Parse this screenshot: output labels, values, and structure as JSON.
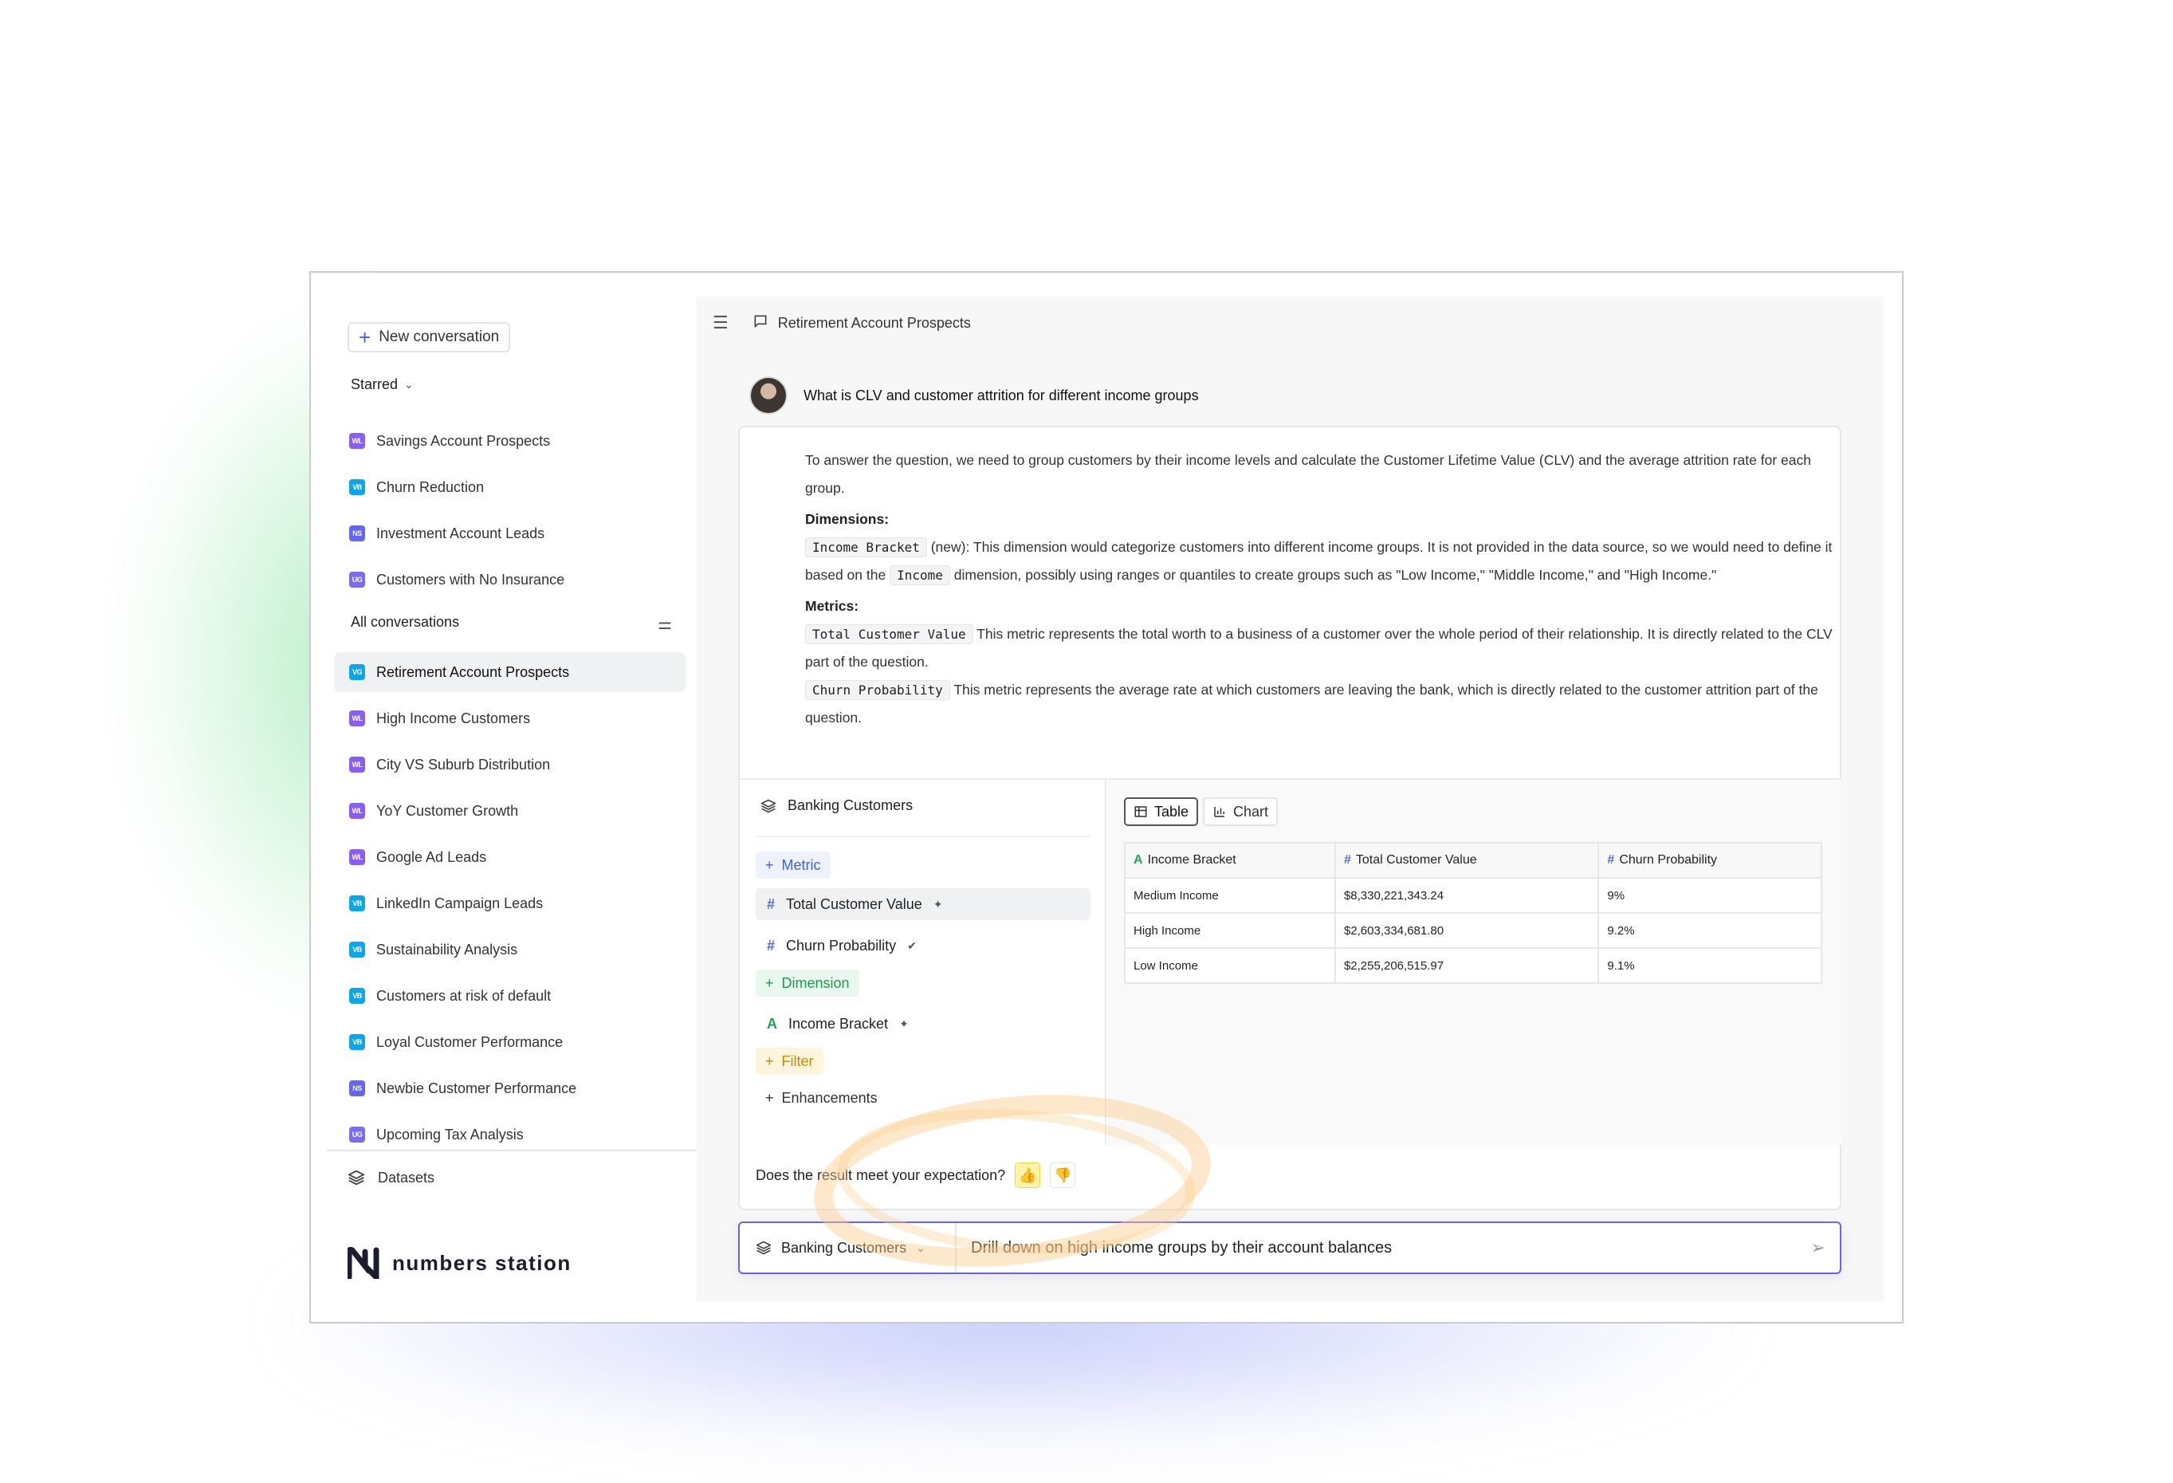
{
  "colors": {
    "accent": "#4b5cf0",
    "badge_wl": "#8b5cf6",
    "badge_vb": "#0ea5e9",
    "badge_ns": "#6366f1",
    "badge_ug": "#7c6cf0",
    "metric": "#3a63e0",
    "dimension": "#1e9a4f",
    "filter": "#c98a00"
  },
  "sidebar": {
    "new_conversation": "New conversation",
    "starred_label": "Starred",
    "starred": [
      {
        "badge": "WL",
        "label": "Savings Account Prospects"
      },
      {
        "badge": "VB",
        "label": "Churn Reduction"
      },
      {
        "badge": "NS",
        "label": "Investment Account Leads"
      },
      {
        "badge": "UG",
        "label": "Customers with No Insurance"
      }
    ],
    "all_label": "All conversations",
    "conversations": [
      {
        "badge": "VG",
        "label": "Retirement Account Prospects"
      },
      {
        "badge": "WL",
        "label": "High Income Customers"
      },
      {
        "badge": "WL",
        "label": "City VS Suburb Distribution"
      },
      {
        "badge": "WL",
        "label": "YoY Customer Growth"
      },
      {
        "badge": "WL",
        "label": "Google Ad Leads"
      },
      {
        "badge": "VB",
        "label": "LinkedIn Campaign Leads"
      },
      {
        "badge": "VB",
        "label": "Sustainability Analysis"
      },
      {
        "badge": "VB",
        "label": "Customers at risk of default"
      },
      {
        "badge": "VB",
        "label": "Loyal Customer Performance"
      },
      {
        "badge": "NS",
        "label": "Newbie Customer Performance"
      },
      {
        "badge": "UG",
        "label": "Upcoming Tax Analysis"
      }
    ],
    "datasets": "Datasets",
    "logo": "numbers station"
  },
  "topbar": {
    "title": "Retirement Account Prospects"
  },
  "question": "What is CLV and customer attrition for different income groups",
  "answer": {
    "intro": "To answer the question, we need to group customers by their income levels and calculate the Customer Lifetime Value (CLV) and the average attrition rate for each group.",
    "dimensions_label": "Dimensions:",
    "dim_code": "Income Bracket",
    "dim_text_1": "(new): This dimension would categorize customers into different income groups. It is not provided in the data source, so we would need to define it based on the",
    "dim_code_2": "Income",
    "dim_text_2": "dimension, possibly using ranges or quantiles to create groups such as \"Low Income,\" \"Middle Income,\" and \"High Income.\"",
    "metrics_label": "Metrics:",
    "m1_code": "Total Customer Value",
    "m1_text": "This metric represents the total worth to a business of a customer over the whole period of their relationship. It is directly related to the CLV part of the question.",
    "m2_code": "Churn Probability",
    "m2_text": "This metric represents the average rate at which customers are leaving the bank, which is directly related to the customer attrition part of the question."
  },
  "builder": {
    "dataset": "Banking Customers",
    "metric": "Metric",
    "metric_fields": [
      "Total Customer Value",
      "Churn Probability"
    ],
    "dimension": "Dimension",
    "dimension_fields": [
      "Income Bracket"
    ],
    "filter": "Filter",
    "enhancements": "Enhancements"
  },
  "results": {
    "tab_table": "Table",
    "tab_chart": "Chart",
    "columns": [
      "Income Bracket",
      "Total Customer Value",
      "Churn Probability"
    ],
    "rows": [
      [
        "Medium Income",
        "$8,330,221,343.24",
        "9%"
      ],
      [
        "High Income",
        "$2,603,334,681.80",
        "9.2%"
      ],
      [
        "Low Income",
        "$2,255,206,515.97",
        "9.1%"
      ]
    ]
  },
  "feedback": {
    "question": "Does the result meet your expectation?"
  },
  "input": {
    "dataset": "Banking Customers",
    "text": "Drill down on high income groups by their account balances"
  }
}
